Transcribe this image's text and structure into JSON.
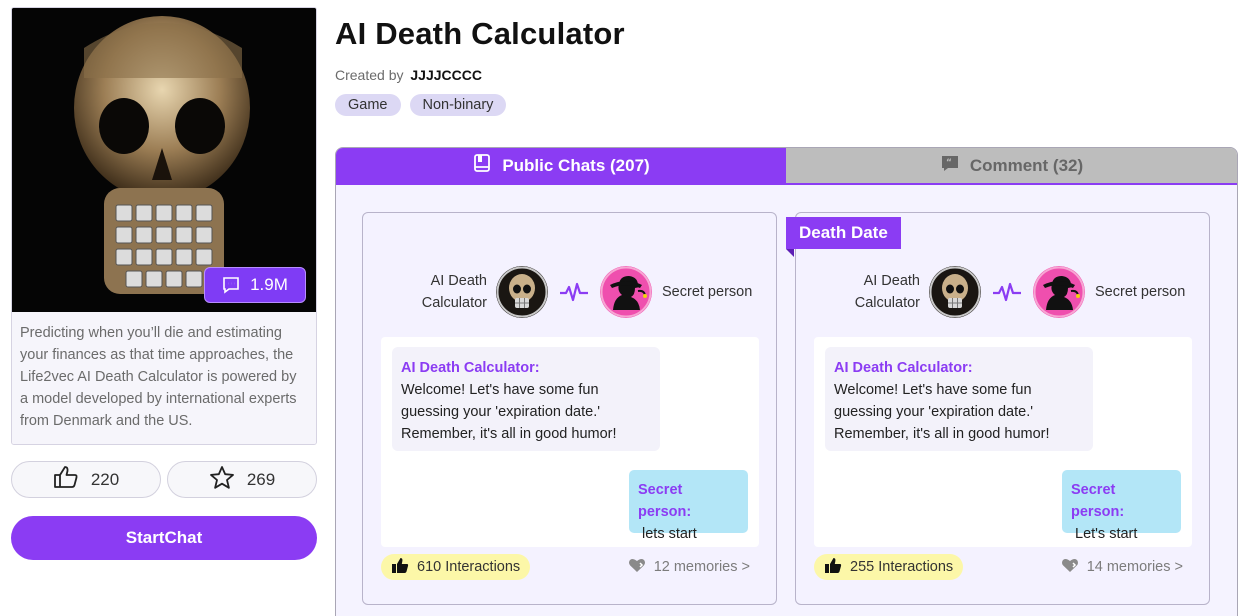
{
  "character": {
    "views": "1.9M",
    "description": "Predicting when you’ll die and estimating your finances as that time approaches, the Life2vec AI Death Calculator is powered by a model developed by international experts from Denmark and the US.",
    "likes": "220",
    "favorites": "269",
    "start_label": "StartChat",
    "title": "AI Death Calculator",
    "created_by_label": "Created by",
    "creator": "JJJJCCCC",
    "tags": [
      "Game",
      "Non-binary"
    ]
  },
  "tabs": {
    "public_chats": "Public Chats (207)",
    "comment": "Comment (32)"
  },
  "chats": [
    {
      "ribbon": "",
      "bot_name_line1": "AI Death",
      "bot_name_line2": "Calculator",
      "user_name": "Secret person",
      "bot_speaker": "AI Death Calculator:",
      "bot_message": " Welcome! Let's have some fun guessing your 'expiration date.' Remember, it's all in good humor!",
      "user_speaker": "Secret person:",
      "user_message": "lets start",
      "interactions": "610 Interactions",
      "memories": "12 memories >"
    },
    {
      "ribbon": "Death Date",
      "bot_name_line1": "AI Death",
      "bot_name_line2": "Calculator",
      "user_name": "Secret person",
      "bot_speaker": "AI Death Calculator:",
      "bot_message": " Welcome! Let's have some fun guessing your 'expiration date.' Remember, it's all in good humor!",
      "user_speaker": "Secret person:",
      "user_message": "Let's start",
      "interactions": "255 Interactions",
      "memories": "14 memories >"
    }
  ],
  "colors": {
    "accent": "#8b3cf3",
    "tab_inactive": "#bdbdbd",
    "interaction_badge": "#fcf7a8",
    "user_bubble": "#b3e6f7"
  },
  "icons": {
    "views": "chat-bubble-icon",
    "likes": "thumbs-up-icon",
    "favorites": "star-icon",
    "public_chats": "book-icon",
    "comment": "quote-icon",
    "interactions": "thumbs-up-icon",
    "memories": "heart-icon",
    "connector": "pulse-icon"
  }
}
